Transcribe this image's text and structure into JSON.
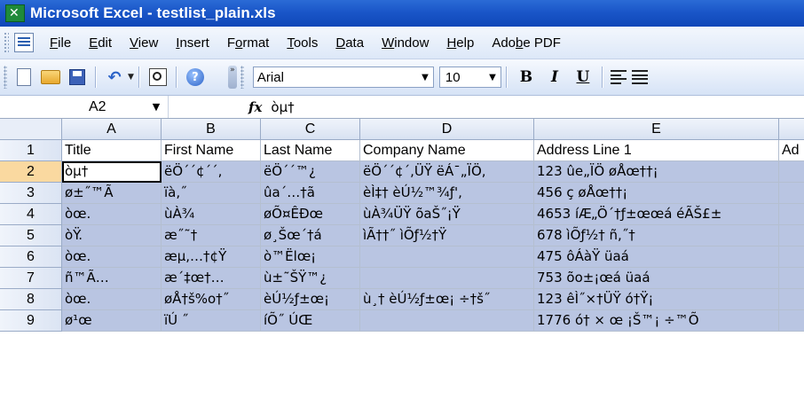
{
  "window": {
    "title": "Microsoft Excel - testlist_plain.xls"
  },
  "menu": {
    "items": [
      {
        "label": "File",
        "ul": "F",
        "rest": "ile"
      },
      {
        "label": "Edit",
        "ul": "E",
        "rest": "dit"
      },
      {
        "label": "View",
        "ul": "V",
        "rest": "iew"
      },
      {
        "label": "Insert",
        "ul": "I",
        "rest": "nsert"
      },
      {
        "label": "Format",
        "pre": "F",
        "ul": "o",
        "rest": "rmat"
      },
      {
        "label": "Tools",
        "ul": "T",
        "rest": "ools"
      },
      {
        "label": "Data",
        "ul": "D",
        "rest": "ata"
      },
      {
        "label": "Window",
        "ul": "W",
        "rest": "indow"
      },
      {
        "label": "Help",
        "ul": "H",
        "rest": "elp"
      },
      {
        "label": "Adobe PDF",
        "pre": "Ado",
        "ul": "b",
        "rest": "e PDF"
      }
    ]
  },
  "toolbar": {
    "font_name": "Arial",
    "font_size": "10",
    "bold_label": "B",
    "italic_label": "I",
    "underline_label": "U"
  },
  "formula_bar": {
    "name_box": "A2",
    "fx_label": "fx",
    "value": "òµ†"
  },
  "sheet": {
    "columns": [
      "A",
      "B",
      "C",
      "D",
      "E"
    ],
    "rows": [
      {
        "num": "1",
        "cells": [
          "Title",
          "First Name",
          "Last Name",
          "Company Name",
          "Address Line 1",
          "Ad"
        ]
      },
      {
        "num": "2",
        "cells": [
          "òµ†",
          "ëÖ´´¢´´,",
          "ëÖ´´™¿",
          "ëÖ´´¢´,ÜŸ ëÁ¯„ÏÖ,",
          "123 ûe„ÏÖ øÅœ††¡",
          ""
        ]
      },
      {
        "num": "3",
        "cells": [
          "ø±˝™Ã",
          "ïà,˝",
          "ûa´…†ã",
          "èÌ‡† èÚ½™¾ƒ',",
          "456 ç øÅœ††¡",
          ""
        ]
      },
      {
        "num": "4",
        "cells": [
          "òœ.",
          "ùÀ¾",
          "øÕ¤ÊÐœ",
          "ùÀ¾ÜŸ õaŠ˝¡Ÿ",
          "4653 íÆ„Ö´†ƒ±œœá éÃŠ£±",
          ""
        ]
      },
      {
        "num": "5",
        "cells": [
          "òŸ.",
          "æ˝˜†",
          "ø¸Šœ´†á",
          "ìÃ††˝ ìÕƒ½†Ÿ",
          "678 ìÕƒ½† ñ,˝†",
          ""
        ]
      },
      {
        "num": "6",
        "cells": [
          "òœ.",
          "æµ,…†¢Ÿ",
          "ò™Ëlœ¡",
          "",
          "475 ôÁàŸ üaá",
          ""
        ]
      },
      {
        "num": "7",
        "cells": [
          "ñ™Ã…",
          "æ´‡œ†…",
          "ù±˜ŠŸ™¿",
          "",
          "753 õo±¡œá üaá",
          ""
        ]
      },
      {
        "num": "8",
        "cells": [
          "òœ.",
          "øÅ†š%o†˝",
          "èÚ½ƒ±œ¡",
          "ù¸† èÚ½ƒ±œ¡ ÷†š˝",
          "123 êÌ˝×†ÜŸ ó†Ÿ¡",
          ""
        ]
      },
      {
        "num": "9",
        "cells": [
          "ø¹œ",
          "ïÚ ˝",
          "íÕ˝ ÚŒ",
          "",
          "1776 ó† × œ ¡Š™¡ ÷™Õ",
          ""
        ]
      }
    ]
  },
  "colors": {
    "title_bar": "#1a56c8",
    "selection": "#b9c5e2",
    "header_active": "#fad9a0"
  }
}
